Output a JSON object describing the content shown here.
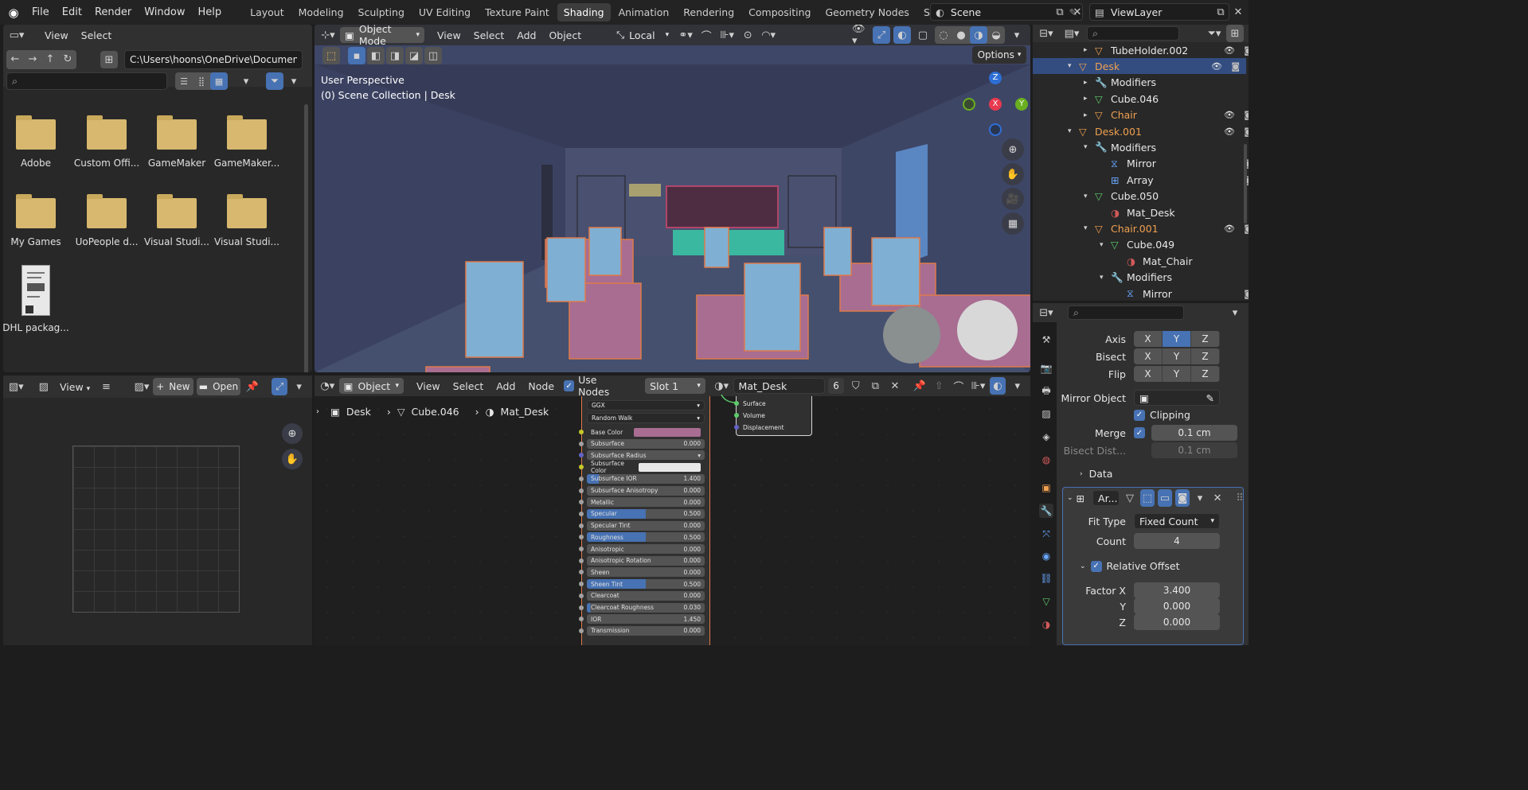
{
  "topbar": {
    "menus": [
      "File",
      "Edit",
      "Render",
      "Window",
      "Help"
    ],
    "workspaces": [
      "Layout",
      "Modeling",
      "Sculpting",
      "UV Editing",
      "Texture Paint",
      "Shading",
      "Animation",
      "Rendering",
      "Compositing",
      "Geometry Nodes",
      "Scripting"
    ],
    "active_workspace": "Shading",
    "scene": "Scene",
    "view_layer": "ViewLayer"
  },
  "file_browser": {
    "menus": [
      "View",
      "Select"
    ],
    "path": "C:\\Users\\hoons\\OneDrive\\Documents\\",
    "items": [
      "Adobe",
      "Custom Offi...",
      "GameMaker",
      "GameMaker...",
      "My Games",
      "UoPeople d...",
      "Visual Studi...",
      "Visual Studi...",
      "DHL packag..."
    ]
  },
  "viewport": {
    "mode": "Object Mode",
    "menus": [
      "View",
      "Select",
      "Add",
      "Object"
    ],
    "transform_orientation": "Local",
    "options_label": "Options",
    "overlay_line1": "User Perspective",
    "overlay_line2": "(0) Scene Collection | Desk",
    "gizmo": {
      "x": "X",
      "y": "Y",
      "z": "Z"
    }
  },
  "image_editor": {
    "view_label": "View",
    "new_label": "New",
    "open_label": "Open"
  },
  "node_editor": {
    "mode": "Object",
    "menus": [
      "View",
      "Select",
      "Add",
      "Node"
    ],
    "use_nodes_label": "Use Nodes",
    "slot": "Slot 1",
    "material": "Mat_Desk",
    "users": "6",
    "breadcrumb": [
      "Desk",
      "Cube.046",
      "Mat_Desk"
    ],
    "bsdf": {
      "distribution": "GGX",
      "subsurface_method": "Random Walk",
      "rows": [
        {
          "label": "Base Color",
          "value": ""
        },
        {
          "label": "Subsurface",
          "value": "0.000"
        },
        {
          "label": "Subsurface Radius",
          "value": ""
        },
        {
          "label": "Subsurface Color",
          "value": ""
        },
        {
          "label": "Subsurface IOR",
          "value": "1.400"
        },
        {
          "label": "Subsurface Anisotropy",
          "value": "0.000"
        },
        {
          "label": "Metallic",
          "value": "0.000"
        },
        {
          "label": "Specular",
          "value": "0.500"
        },
        {
          "label": "Specular Tint",
          "value": "0.000"
        },
        {
          "label": "Roughness",
          "value": "0.500"
        },
        {
          "label": "Anisotropic",
          "value": "0.000"
        },
        {
          "label": "Anisotropic Rotation",
          "value": "0.000"
        },
        {
          "label": "Sheen",
          "value": "0.000"
        },
        {
          "label": "Sheen Tint",
          "value": "0.500"
        },
        {
          "label": "Clearcoat",
          "value": "0.000"
        },
        {
          "label": "Clearcoat Roughness",
          "value": "0.030"
        },
        {
          "label": "IOR",
          "value": "1.450"
        },
        {
          "label": "Transmission",
          "value": "0.000"
        }
      ]
    },
    "output_sockets": [
      "Surface",
      "Volume",
      "Displacement"
    ]
  },
  "outliner": {
    "rows": [
      {
        "label": "TubeHolder.002",
        "icon": "mesh-object-icon",
        "indent": 1,
        "tri": "▸",
        "color": "#e8e8e8"
      },
      {
        "label": "Desk",
        "icon": "mesh-object-icon",
        "indent": 0,
        "tri": "▾",
        "color": "#f0a050"
      },
      {
        "label": "Modifiers",
        "icon": "wrench-icon",
        "indent": 1,
        "tri": "▸",
        "color": "#e8e8e8"
      },
      {
        "label": "Cube.046",
        "icon": "mesh-data-icon",
        "indent": 1,
        "tri": "▸",
        "color": "#e8e8e8"
      },
      {
        "label": "Chair",
        "icon": "mesh-object-icon",
        "indent": 1,
        "tri": "▸",
        "color": "#f0a050"
      },
      {
        "label": "Desk.001",
        "icon": "mesh-object-icon",
        "indent": 0,
        "tri": "▾",
        "color": "#f0a050"
      },
      {
        "label": "Modifiers",
        "icon": "wrench-icon",
        "indent": 1,
        "tri": "▾",
        "color": "#e8e8e8"
      },
      {
        "label": "Mirror",
        "icon": "mirror-modifier-icon",
        "indent": 2,
        "tri": "",
        "color": "#e8e8e8"
      },
      {
        "label": "Array",
        "icon": "array-modifier-icon",
        "indent": 2,
        "tri": "",
        "color": "#e8e8e8"
      },
      {
        "label": "Cube.050",
        "icon": "mesh-data-icon",
        "indent": 1,
        "tri": "▾",
        "color": "#e8e8e8"
      },
      {
        "label": "Mat_Desk",
        "icon": "material-icon",
        "indent": 2,
        "tri": "",
        "color": "#e8e8e8"
      },
      {
        "label": "Chair.001",
        "icon": "mesh-object-icon",
        "indent": 1,
        "tri": "▾",
        "color": "#f0a050"
      },
      {
        "label": "Cube.049",
        "icon": "mesh-data-icon",
        "indent": 2,
        "tri": "▾",
        "color": "#e8e8e8"
      },
      {
        "label": "Mat_Chair",
        "icon": "material-icon",
        "indent": 3,
        "tri": "",
        "color": "#e8e8e8"
      },
      {
        "label": "Modifiers",
        "icon": "wrench-icon",
        "indent": 2,
        "tri": "▾",
        "color": "#e8e8e8"
      },
      {
        "label": "Mirror",
        "icon": "mirror-modifier-icon",
        "indent": 3,
        "tri": "",
        "color": "#e8e8e8"
      }
    ]
  },
  "properties": {
    "axis_label": "Axis",
    "bisect_label": "Bisect",
    "flip_label": "Flip",
    "xyz": [
      "X",
      "Y",
      "Z"
    ],
    "mirror_object_label": "Mirror Object",
    "clipping_label": "Clipping",
    "merge_label": "Merge",
    "merge_value": "0.1 cm",
    "bisect_distance_label": "Bisect Dist...",
    "bisect_distance_value": "0.1 cm",
    "data_label": "Data",
    "array_name": "Ar...",
    "fit_type_label": "Fit Type",
    "fit_type_value": "Fixed Count",
    "count_label": "Count",
    "count_value": "4",
    "relative_offset_label": "Relative Offset",
    "factor_x_label": "Factor X",
    "factor_x_value": "3.400",
    "y_label": "Y",
    "y_value": "0.000",
    "z_label": "Z",
    "z_value": "0.000"
  },
  "colors": {
    "accent": "#4772b3",
    "object_orange": "#f0a050",
    "mesh_green": "#5ecb6b",
    "desk_pink": "#a86d91",
    "chair_blue": "#7fb0d4"
  }
}
